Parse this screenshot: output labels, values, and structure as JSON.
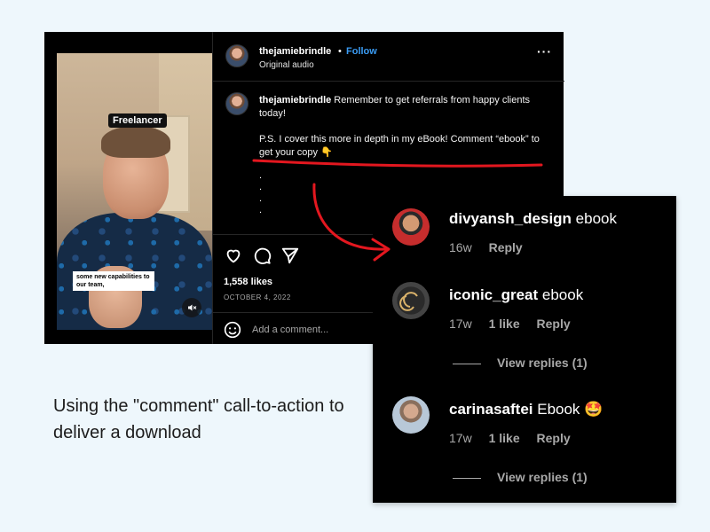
{
  "post": {
    "video": {
      "tag": "Freelancer",
      "caption": "some new capabilities to our team,"
    },
    "header": {
      "username": "thejamiebrindle",
      "separator": "•",
      "follow_label": "Follow",
      "audio": "Original audio",
      "more_label": "···"
    },
    "caption": {
      "username": "thejamiebrindle",
      "text": "Remember to get referrals from happy clients today!",
      "ps": "P.S. I cover this more in depth in my eBook! Comment “ebook” to get your copy 👇",
      "dots": ".\n.\n.\n."
    },
    "likes": "1,558 likes",
    "date": "OCTOBER 4, 2022",
    "add_comment_placeholder": "Add a comment..."
  },
  "comments": [
    {
      "username": "divyansh_design",
      "text": "ebook",
      "age": "16w",
      "likes": "",
      "reply": "Reply",
      "view_replies": ""
    },
    {
      "username": "iconic_great",
      "text": "ebook",
      "age": "17w",
      "likes": "1 like",
      "reply": "Reply",
      "view_replies": "View replies (1)"
    },
    {
      "username": "carinasaftei",
      "text": "Ebook 🤩",
      "age": "17w",
      "likes": "1 like",
      "reply": "Reply",
      "view_replies": "View replies (1)"
    }
  ],
  "promo_text": "Using the \"comment\" call-to-action to deliver a download",
  "colors": {
    "background": "#eef7fc",
    "follow": "#3a9bf3",
    "annotation_red": "#e3171f"
  }
}
